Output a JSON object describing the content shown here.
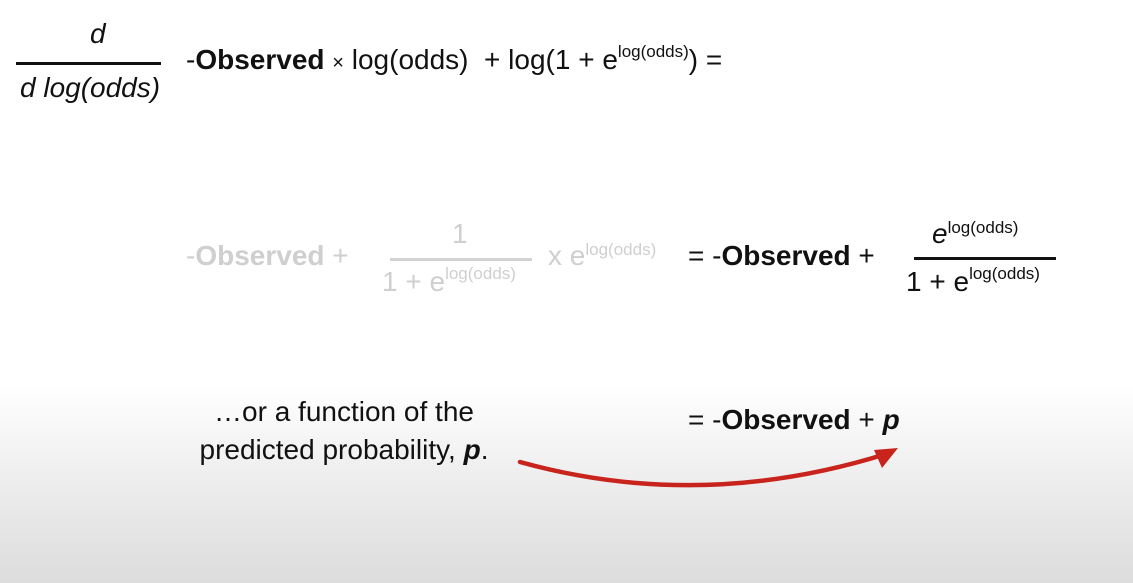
{
  "row1": {
    "numerator": "d",
    "denominator": "d log(odds)",
    "neg": "-",
    "observed": "Observed",
    "times": "×",
    "logodds": "log(odds)",
    "plus_log": "+ log(1 + e",
    "exponent": "log(odds)",
    "close_eq": ") ="
  },
  "row2": {
    "lhs_neg": "-",
    "lhs_observed": "Observed",
    "lhs_plus": "+",
    "frac1_num": "1",
    "frac1_den_base": "1 + e",
    "frac1_den_exp": "log(odds)",
    "times_e": "x e",
    "times_exp": "log(odds)",
    "eq": "=",
    "rhs_neg": "-",
    "rhs_observed": "Observed",
    "rhs_plus": "+",
    "frac2_num_base": "e",
    "frac2_num_exp": "log(odds)",
    "frac2_den_base": "1 + e",
    "frac2_den_exp": "log(odds)"
  },
  "row3": {
    "caption_line1": "…or a function of the",
    "caption_line2": "predicted probability,",
    "caption_p": "p",
    "caption_end": ".",
    "eq": "=",
    "neg": "-",
    "observed": "Observed",
    "plus": "+",
    "p": "p"
  },
  "colors": {
    "text": "#111111",
    "faded": "#cfcfcf",
    "arrow": "#c8231c"
  }
}
